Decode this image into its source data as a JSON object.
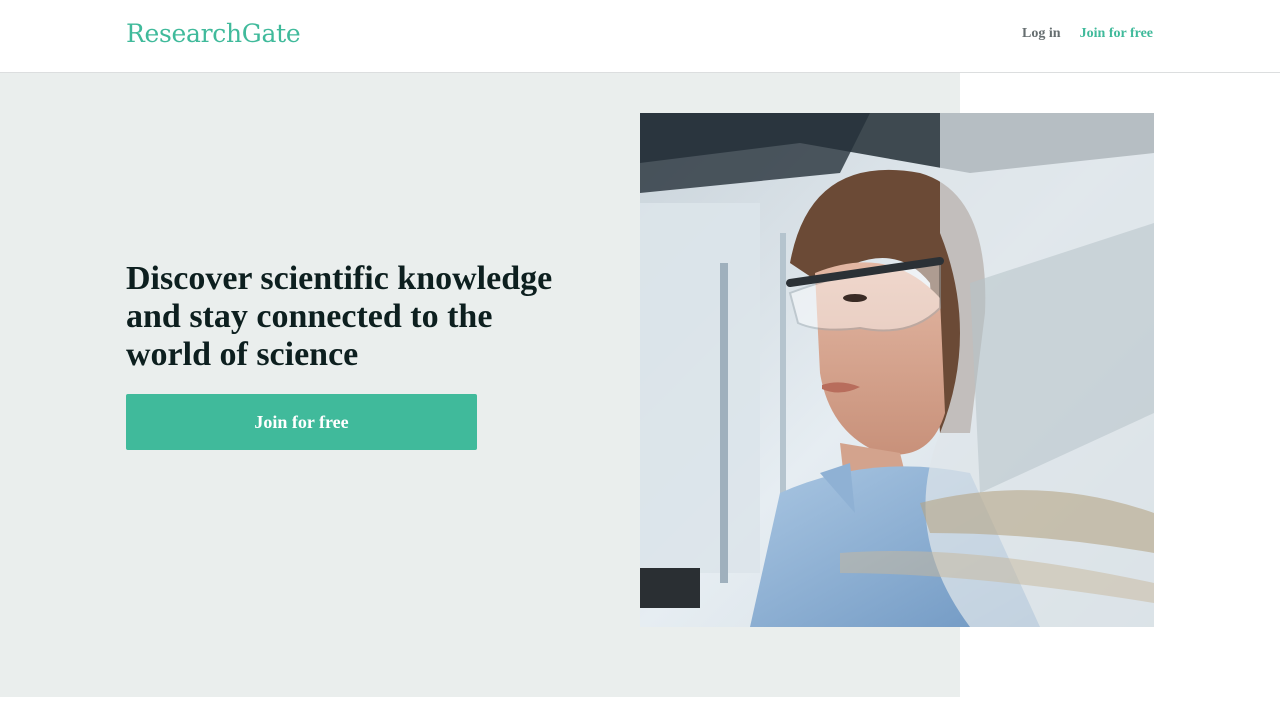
{
  "header": {
    "logo": "ResearchGate",
    "login_label": "Log in",
    "join_label": "Join for free"
  },
  "hero": {
    "headline": "Discover scientific knowledge and stay connected to the world of science",
    "cta_label": "Join for free"
  },
  "colors": {
    "brand": "#40ba9b",
    "hero_background": "#eaeeed",
    "heading": "#0d1f1f",
    "nav_text": "#666e70"
  }
}
